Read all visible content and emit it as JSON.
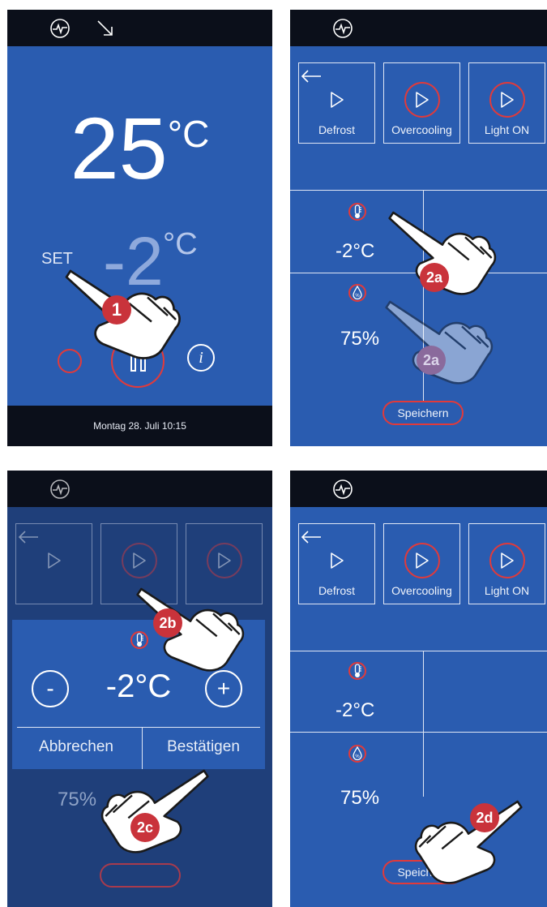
{
  "panel1": {
    "temperature": "25",
    "temperature_unit": "°C",
    "set_label": "SET",
    "set_value": "-2",
    "set_unit": "°C",
    "info_label": "i",
    "footer_datetime": "Montag 28. Juli 10:15",
    "step": "1"
  },
  "panel2": {
    "tiles": [
      {
        "label": "Defrost"
      },
      {
        "label": "Overcooling"
      },
      {
        "label": "Light ON"
      }
    ],
    "temperature_value": "-2°C",
    "humidity_value": "75%",
    "save_label": "Speichern",
    "step_a": "2a",
    "step_a2": "2a"
  },
  "panel3": {
    "minus_label": "-",
    "plus_label": "+",
    "dialog_value": "-2°C",
    "cancel_label": "Abbrechen",
    "confirm_label": "Bestätigen",
    "humidity_value": "75%",
    "step_b": "2b",
    "step_c": "2c"
  },
  "panel4": {
    "tiles": [
      {
        "label": "Defrost"
      },
      {
        "label": "Overcooling"
      },
      {
        "label": "Light ON"
      }
    ],
    "temperature_value": "-2°C",
    "humidity_value": "75%",
    "save_label": "Speichern",
    "step_d": "2d"
  },
  "colors": {
    "screen_blue": "#2a5cb0",
    "bar_dark": "#0b0f1a",
    "accent_red": "#e23a3a",
    "step_badge": "#c9333b"
  }
}
